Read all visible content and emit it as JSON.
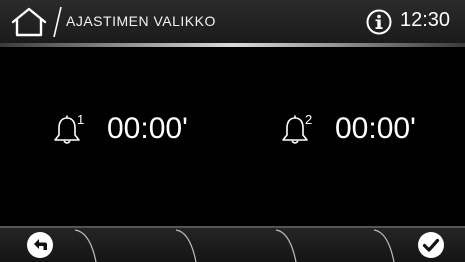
{
  "header": {
    "title": "AJASTIMEN VALIKKO",
    "clock": "12:30",
    "home_icon": "home-icon",
    "info_icon": "info-icon"
  },
  "timers": [
    {
      "index": "1",
      "value": "00:00'",
      "icon": "bell-icon"
    },
    {
      "index": "2",
      "value": "00:00'",
      "icon": "bell-icon"
    }
  ],
  "footer": {
    "back_icon": "back-arrow-icon",
    "confirm_icon": "checkmark-icon"
  },
  "colors": {
    "background": "#000000",
    "bar": "#222222",
    "text": "#ffffff"
  }
}
